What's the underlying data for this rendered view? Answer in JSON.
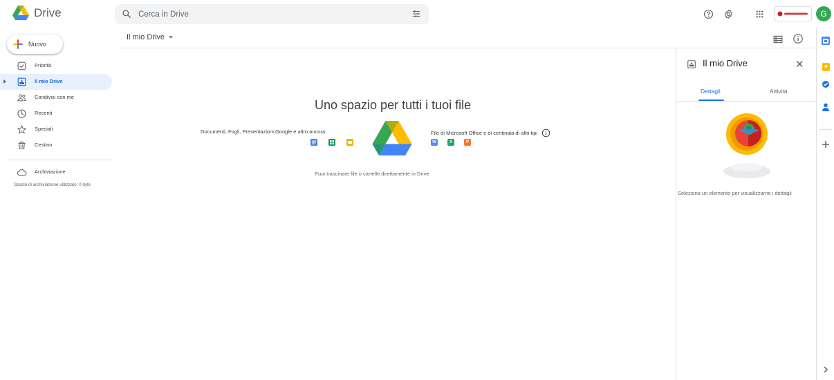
{
  "app": {
    "name": "Drive"
  },
  "search": {
    "placeholder": "Cerca in Drive",
    "value": ""
  },
  "header": {
    "icons": [
      "help-icon",
      "settings-icon",
      "apps-grid-icon"
    ],
    "avatar_letter": "G"
  },
  "sidebar": {
    "new_label": "Nuovo",
    "items": [
      {
        "label": "Priorità",
        "icon": "priority-icon"
      },
      {
        "label": "Il mio Drive",
        "icon": "my-drive-icon",
        "active": true
      },
      {
        "label": "Condivisi con me",
        "icon": "shared-icon"
      },
      {
        "label": "Recenti",
        "icon": "recent-clock-icon"
      },
      {
        "label": "Speciali",
        "icon": "star-icon"
      },
      {
        "label": "Cestino",
        "icon": "trash-icon"
      }
    ],
    "storage": {
      "label": "Archiviazione",
      "used": "Spazio di archiviazione utilizzato: 0 byte"
    }
  },
  "main": {
    "breadcrumb": "Il mio Drive",
    "empty_title": "Uno spazio per tutti i tuoi file",
    "left_caption": "Documenti, Fogli, Presentazioni Google e altro ancora",
    "right_caption": "File di Microsoft Office e di centinaia di altri tipi",
    "ms_apps": [
      "W",
      "X",
      "P"
    ],
    "drag_hint": "Puoi trascinare file o cartelle direttamente in Drive"
  },
  "details": {
    "title": "Il mio Drive",
    "tabs": [
      "Dettagli",
      "Attività"
    ],
    "active_tab": "Dettagli",
    "hint": "Seleziona un elemento per visualizzarne i dettagli"
  },
  "colors": {
    "accent": "#1a73e8",
    "active_bg": "#e8f0fe",
    "docs": "#4285f4",
    "sheets": "#0f9d58",
    "slides": "#f4b400",
    "word": "#4f8ef7",
    "excel": "#20a464",
    "powerpoint": "#f4742c"
  }
}
